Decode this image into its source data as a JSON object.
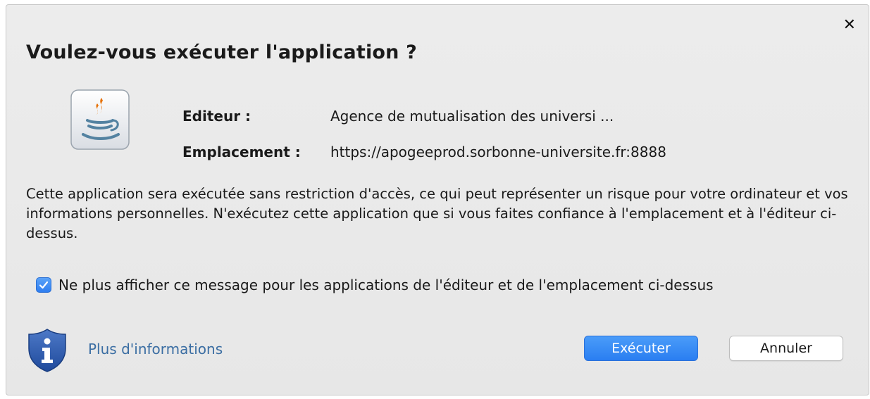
{
  "dialog": {
    "title": "Voulez-vous exécuter l'application ?",
    "close_icon": "close-icon",
    "app_icon": "java-icon",
    "publisher_label": "Editeur :",
    "publisher_value": "Agence de mutualisation des universi ...",
    "location_label": "Emplacement :",
    "location_value": "https://apogeeprod.sorbonne-universite.fr:8888",
    "warning_text": "Cette application sera exécutée sans restriction d'accès, ce qui peut représenter un risque pour votre ordinateur et vos informations personnelles. N'exécutez cette application que si vous faites confiance à l'emplacement et à l'éditeur ci-dessus.",
    "checkbox": {
      "checked": true,
      "label": "Ne plus afficher ce message pour les applications de l'éditeur et de l'emplacement ci-dessus"
    },
    "info_icon": "shield-info-icon",
    "more_info_link": "Plus d'informations",
    "run_button": "Exécuter",
    "cancel_button": "Annuler"
  },
  "colors": {
    "accent": "#2f7ef0",
    "link": "#3b6ea3",
    "background": "#ececec"
  }
}
